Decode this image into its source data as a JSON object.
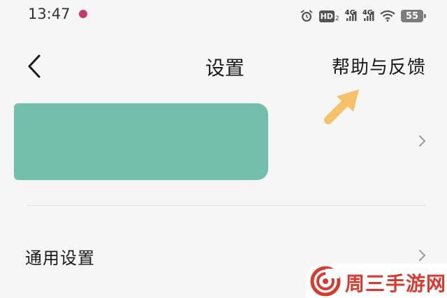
{
  "status_bar": {
    "time": "13:47",
    "hd_label": "HD",
    "hd_sub": "2",
    "signal1_label": "4G",
    "signal2_label": "4G",
    "battery": "55",
    "icons": [
      "alarm-icon",
      "hd-icon",
      "signal-icon",
      "signal-icon",
      "wifi-icon",
      "battery-icon"
    ]
  },
  "header": {
    "title": "设置",
    "help_label": "帮助与反馈"
  },
  "settings": {
    "items": [
      {
        "label": "通用设置"
      }
    ]
  },
  "watermark": {
    "text": "周三手游网"
  },
  "colors": {
    "background": "#f6f6f6",
    "redaction": "#74bfab",
    "arrow": "#f5c169",
    "watermark_red": "#d93a2e"
  }
}
